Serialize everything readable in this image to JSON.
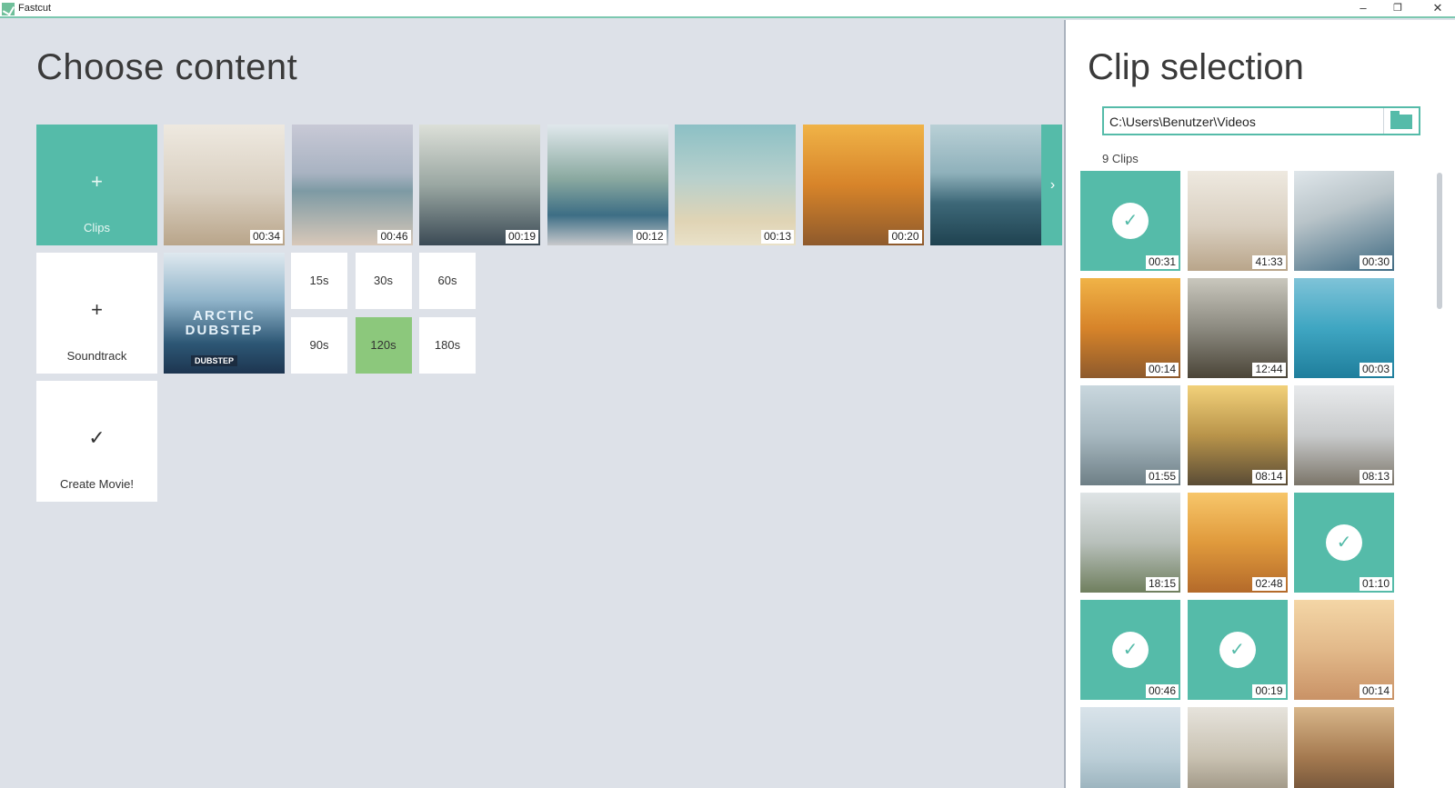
{
  "window": {
    "title": "Fastcut",
    "controls": {
      "minimize": "–",
      "maximize": "❐",
      "close": "✕"
    }
  },
  "left": {
    "title": "Choose content",
    "add_clips": {
      "icon": "+",
      "label": "Clips"
    },
    "clip_thumbs": [
      {
        "duration": "00:34",
        "icon": "beach-parent-child-thumb",
        "bg": "linear-gradient(180deg,#eee9e0 0%,#d9cfc0 55%,#b9a58a 100%)"
      },
      {
        "duration": "00:46",
        "icon": "tropical-beach-thumb",
        "bg": "linear-gradient(180deg,#c8c9d6 0%,#a9b3c2 40%,#7d9aa4 55%,#d8c8b9 100%)"
      },
      {
        "duration": "00:19",
        "icon": "surfers-group-thumb",
        "bg": "linear-gradient(180deg,#dcdfd8 0%,#9aa7a2 50%,#3b4a55 100%)"
      },
      {
        "duration": "00:12",
        "icon": "paddleboard-thumb",
        "bg": "linear-gradient(180deg,#e0e8ec 0%,#8aa9a0 45%,#3d6e85 75%,#c8c9cc 100%)"
      },
      {
        "duration": "00:13",
        "icon": "beach-shore-thumb",
        "bg": "linear-gradient(180deg,#8cc0c5 0%,#b8d0cc 45%,#e0d4b5 80%,#e9e1c8 100%)"
      },
      {
        "duration": "00:20",
        "icon": "surfer-splash-thumb",
        "bg": "linear-gradient(180deg,#f0b347 0%,#d7842a 50%,#8e5a2c 100%)"
      },
      {
        "duration": "",
        "icon": "coastal-town-thumb",
        "bg": "linear-gradient(180deg,#b9d0d6 0%,#8fb1bb 40%,#3d6878 65%,#1f4250 100%)"
      }
    ],
    "next_icon": "›",
    "soundtrack": {
      "icon": "+",
      "label": "Soundtrack",
      "art_title": "ARCTIC DUBSTEP",
      "art_sub": "DUBSTEP"
    },
    "durations": [
      {
        "label": "15s",
        "selected": false
      },
      {
        "label": "30s",
        "selected": false
      },
      {
        "label": "60s",
        "selected": false
      },
      {
        "label": "90s",
        "selected": false
      },
      {
        "label": "120s",
        "selected": true
      },
      {
        "label": "180s",
        "selected": false
      }
    ],
    "create": {
      "icon": "✓",
      "label": "Create Movie!"
    }
  },
  "right": {
    "title": "Clip selection",
    "path_value": "C:\\Users\\Benutzer\\Videos",
    "clip_count": "9 Clips",
    "grid": [
      {
        "duration": "00:31",
        "selected": true,
        "bg": "#5bb8a7"
      },
      {
        "duration": "41:33",
        "selected": false,
        "bg": "linear-gradient(180deg,#eee9e0 0%,#d9cfc0 55%,#b9a58a 100%)"
      },
      {
        "duration": "00:30",
        "selected": false,
        "bg": "linear-gradient(160deg,#dfe6ea 0%,#b9c4c9 40%,#3f6a82 100%)"
      },
      {
        "duration": "00:14",
        "selected": false,
        "bg": "linear-gradient(180deg,#f0b347 0%,#d7842a 50%,#8e5a2c 100%)"
      },
      {
        "duration": "12:44",
        "selected": false,
        "bg": "linear-gradient(180deg,#c9c7bd 0%,#8c8a80 50%,#4b4538 100%)"
      },
      {
        "duration": "00:03",
        "selected": false,
        "bg": "linear-gradient(180deg,#7fc3d8 0%,#3fa6c2 50%,#1f7e9c 100%)"
      },
      {
        "duration": "01:55",
        "selected": false,
        "bg": "linear-gradient(180deg,#c9d7de 0%,#a7b8c0 50%,#6e7f86 100%)"
      },
      {
        "duration": "08:14",
        "selected": false,
        "bg": "linear-gradient(180deg,#f2d17a 0%,#b9944a 50%,#5a4c36 100%)"
      },
      {
        "duration": "08:13",
        "selected": false,
        "bg": "linear-gradient(180deg,#e8eaec 0%,#c8cacb 50%,#7b7569 100%)"
      },
      {
        "duration": "18:15",
        "selected": false,
        "bg": "linear-gradient(180deg,#dfe4e6 0%,#b8c0bb 50%,#6f7f5e 100%)"
      },
      {
        "duration": "02:48",
        "selected": false,
        "bg": "linear-gradient(180deg,#f7c66a 0%,#e09a3c 50%,#b46a2a 100%)"
      },
      {
        "duration": "01:10",
        "selected": true,
        "bg": "#5bb8a7"
      },
      {
        "duration": "00:46",
        "selected": true,
        "bg": "#5bb8a7"
      },
      {
        "duration": "00:19",
        "selected": true,
        "bg": "#5bb8a7"
      },
      {
        "duration": "00:14",
        "selected": false,
        "bg": "linear-gradient(180deg,#f4d6a6 0%,#e2b98a 50%,#c99266 100%)"
      },
      {
        "duration": "",
        "selected": false,
        "bg": "linear-gradient(180deg,#d9e3ea 0%,#bccfd8 50%,#8aa5b0 100%)"
      },
      {
        "duration": "",
        "selected": false,
        "bg": "linear-gradient(180deg,#e6e3dc 0%,#c9c2b2 50%,#8c8270 100%)"
      },
      {
        "duration": "",
        "selected": false,
        "bg": "linear-gradient(180deg,#d8b68a 0%,#a57a50 50%,#5e4430 100%)"
      }
    ]
  },
  "colors": {
    "accent": "#55bba9",
    "selected_duration": "#8cc87c",
    "background": "#dde1e8"
  }
}
